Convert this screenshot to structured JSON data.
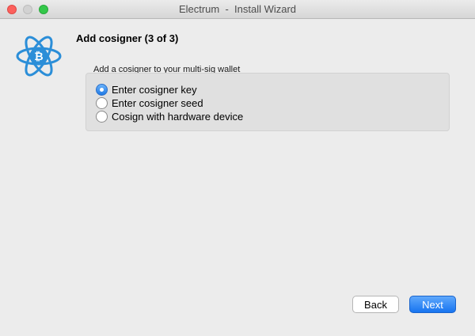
{
  "window": {
    "title": "Electrum  -  Install Wizard"
  },
  "header": {
    "heading": "Add cosigner (3 of 3)"
  },
  "form": {
    "subtitle": "Add a cosigner to your multi-sig wallet",
    "options": [
      {
        "label": "Enter cosigner key",
        "checked": true
      },
      {
        "label": "Enter cosigner seed",
        "checked": false
      },
      {
        "label": "Cosign with hardware device",
        "checked": false
      }
    ]
  },
  "buttons": {
    "back": "Back",
    "next": "Next"
  },
  "colors": {
    "accent": "#1f7ae5",
    "logo": "#2b8ed8"
  },
  "icons": {
    "logo": "electrum-bitcoin-logo-icon"
  }
}
